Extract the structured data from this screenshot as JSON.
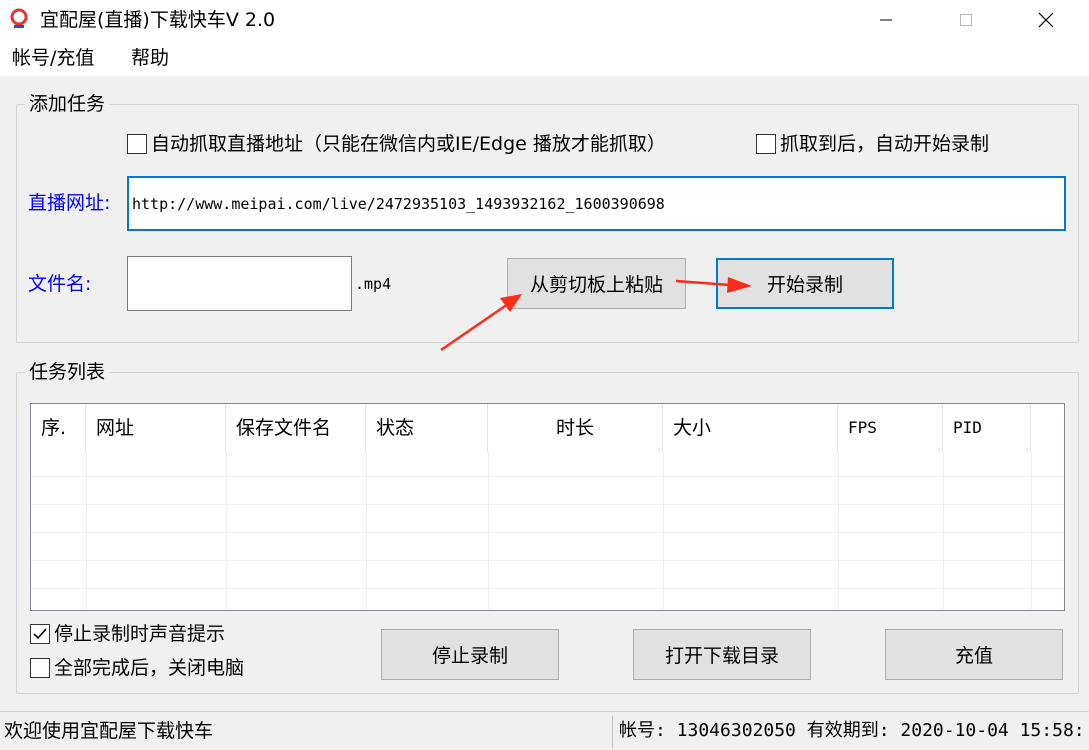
{
  "window": {
    "title": "宜配屋(直播)下载快车V 2.0"
  },
  "menu": {
    "items": [
      "帐号/充值",
      "帮助"
    ]
  },
  "add_task": {
    "group_title": "添加任务",
    "auto_capture_label": "自动抓取直播地址（只能在微信内或IE/Edge 播放才能抓取）",
    "auto_capture_checked": false,
    "auto_start_label": "抓取到后，自动开始录制",
    "auto_start_checked": false,
    "url_label": "直播网址:",
    "url_value": "http://www.meipai.com/live/2472935103_1493932162_1600390698",
    "filename_label": "文件名:",
    "filename_value": "",
    "filename_suffix": ".mp4",
    "paste_button": "从剪切板上粘贴",
    "start_button": "开始录制"
  },
  "task_list": {
    "group_title": "任务列表",
    "columns": [
      "序.",
      "网址",
      "保存文件名",
      "状态",
      "时长",
      "大小",
      "FPS",
      "PID"
    ],
    "rows": []
  },
  "footer": {
    "beep_label": "停止录制时声音提示",
    "beep_checked": true,
    "shutdown_label": "全部完成后，关闭电脑",
    "shutdown_checked": false,
    "stop_button": "停止录制",
    "open_dir_button": "打开下载目录",
    "recharge_button": "充值"
  },
  "status": {
    "left": "欢迎使用宜配屋下载快车",
    "right": "帐号: 13046302050 有效期到: 2020-10-04 15:58:"
  },
  "colors": {
    "accent": "#0078d7",
    "label_blue": "#0000ff",
    "annotation_arrow": "#ff2a1a"
  }
}
